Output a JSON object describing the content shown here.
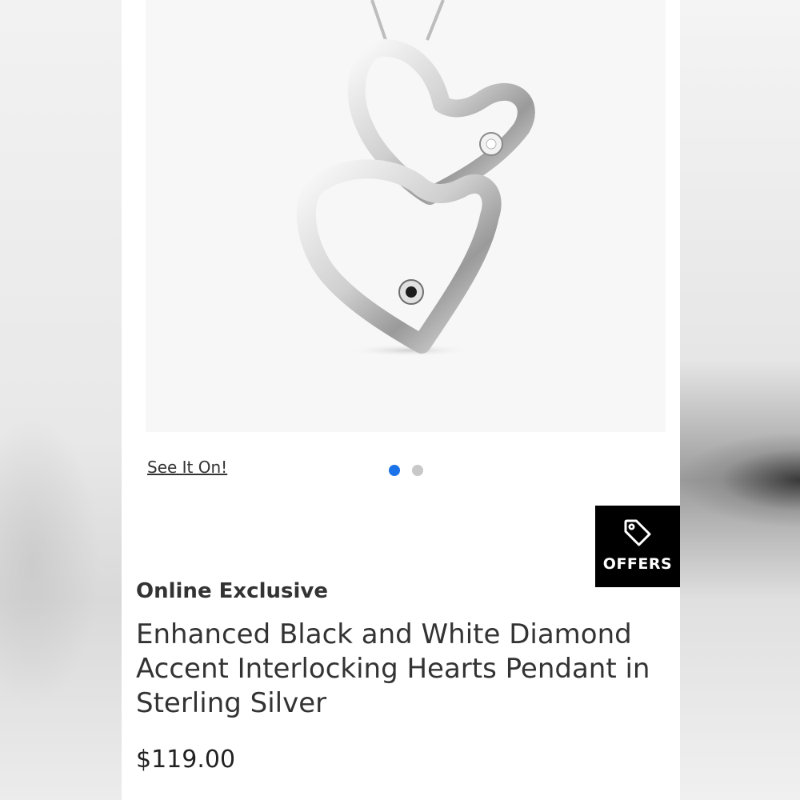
{
  "product": {
    "see_it_on_label": "See It On!",
    "carousel": {
      "total": 2,
      "active_index": 0
    },
    "offers_label": "OFFERS",
    "eyebrow": "Online Exclusive",
    "title": "Enhanced Black and White Diamond Accent Interlocking Hearts Pendant in Sterling Silver",
    "price": "$119.00"
  },
  "icons": {
    "offers": "tag-icon"
  },
  "colors": {
    "active_dot": "#1a73e8",
    "inactive_dot": "#c8c8c8",
    "offers_bg": "#000000"
  }
}
